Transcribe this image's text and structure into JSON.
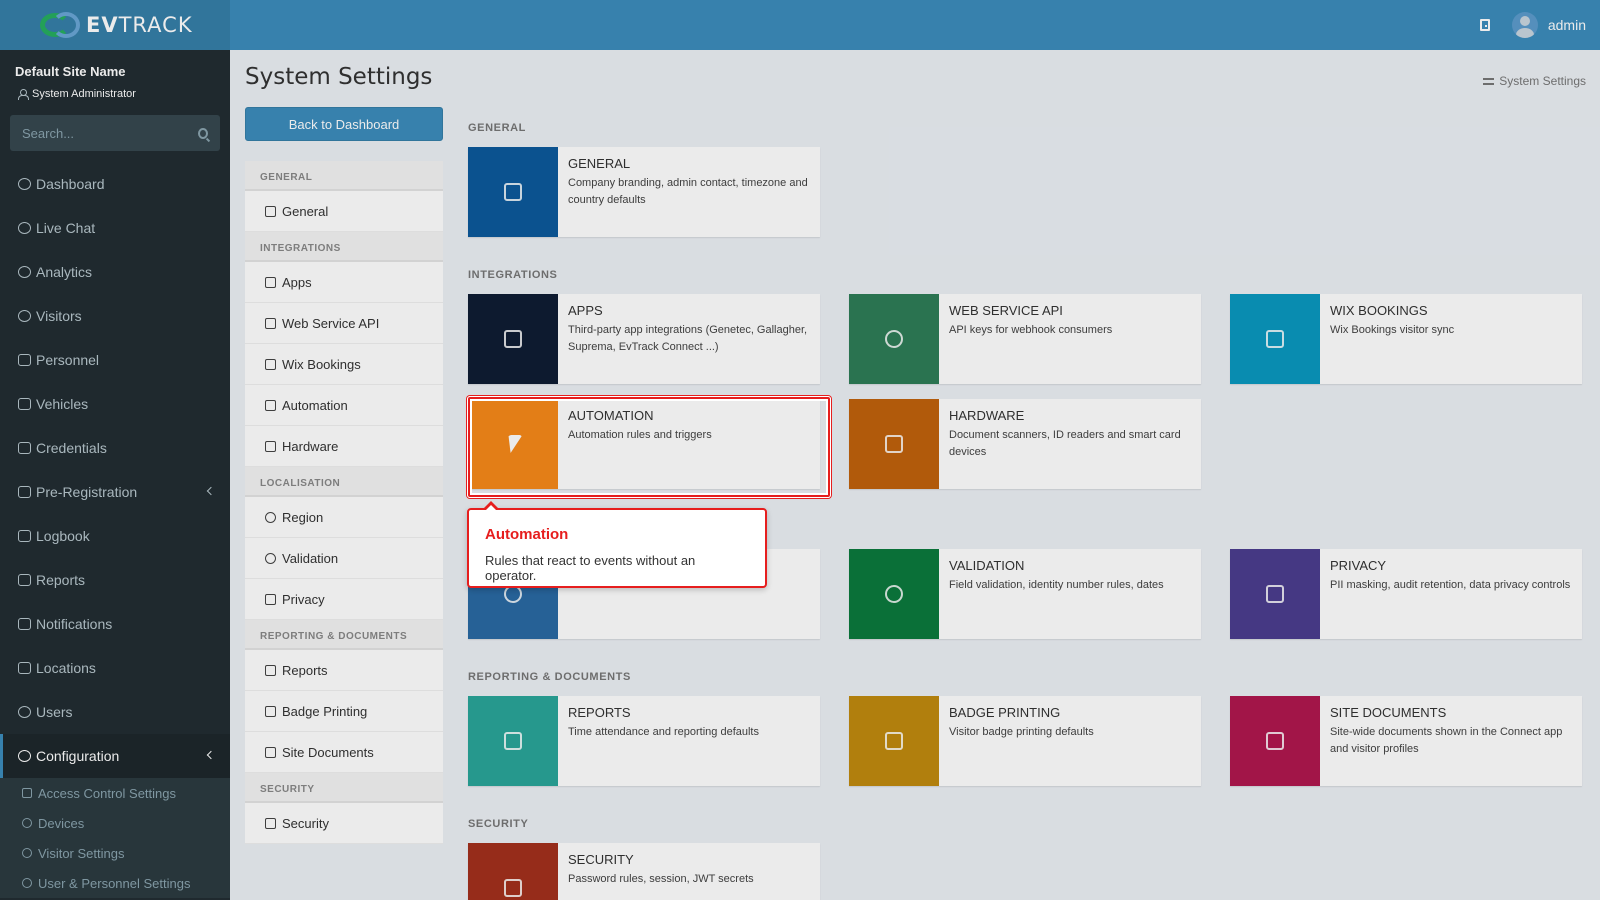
{
  "brand": {
    "logo_bold": "EV",
    "logo_rest": "TRACK"
  },
  "header": {
    "username": "admin"
  },
  "sidebar": {
    "site_name": "Default Site Name",
    "role": "System Administrator",
    "search_placeholder": "Search...",
    "items": [
      {
        "label": "Dashboard",
        "icon": "gauge-icon"
      },
      {
        "label": "Live Chat",
        "icon": "headset-icon"
      },
      {
        "label": "Analytics",
        "icon": "target-icon"
      },
      {
        "label": "Visitors",
        "icon": "eye-icon"
      },
      {
        "label": "Personnel",
        "icon": "user-tie-icon"
      },
      {
        "label": "Vehicles",
        "icon": "car-icon"
      },
      {
        "label": "Credentials",
        "icon": "id-card-icon"
      },
      {
        "label": "Pre-Registration",
        "icon": "exchange-icon"
      },
      {
        "label": "Logbook",
        "icon": "book-icon"
      },
      {
        "label": "Reports",
        "icon": "chart-area-icon"
      },
      {
        "label": "Notifications",
        "icon": "comment-icon"
      },
      {
        "label": "Locations",
        "icon": "map-icon"
      },
      {
        "label": "Users",
        "icon": "users-icon"
      },
      {
        "label": "Configuration",
        "icon": "cog-icon"
      }
    ],
    "sub_items": [
      {
        "label": "Access Control Settings",
        "icon": "lock-icon"
      },
      {
        "label": "Devices",
        "icon": "gear-icon"
      },
      {
        "label": "Visitor Settings",
        "icon": "eye-icon"
      },
      {
        "label": "User & Personnel Settings",
        "icon": "users-icon"
      }
    ]
  },
  "page": {
    "title": "System Settings",
    "breadcrumb": "System Settings",
    "back_button": "Back to Dashboard"
  },
  "settings_nav": {
    "general_head": "GENERAL",
    "general": [
      "General"
    ],
    "integrations_head": "INTEGRATIONS",
    "integrations": [
      "Apps",
      "Web Service API",
      "Wix Bookings",
      "Automation",
      "Hardware"
    ],
    "localisation_head": "LOCALISATION",
    "localisation": [
      "Region",
      "Validation",
      "Privacy"
    ],
    "reporting_head": "REPORTING & DOCUMENTS",
    "reporting": [
      "Reports",
      "Badge Printing",
      "Site Documents"
    ],
    "security_head": "SECURITY",
    "security": [
      "Security"
    ]
  },
  "sections": {
    "general": "GENERAL",
    "integrations": "INTEGRATIONS",
    "reporting": "REPORTING & DOCUMENTS",
    "security": "SECURITY"
  },
  "cards": {
    "general": {
      "title": "GENERAL",
      "desc": "Company branding, admin contact, timezone and country defaults",
      "color": "#0d5a9c",
      "icon": "server-icon"
    },
    "apps": {
      "title": "APPS",
      "desc": "Third-party app integrations (Genetec, Gallagher, Suprema, EvTrack Connect ...)",
      "color": "#0f1d33",
      "icon": "grid-dots-icon"
    },
    "webapi": {
      "title": "WEB SERVICE API",
      "desc": "API keys for webhook consumers",
      "color": "#2e7d57",
      "icon": "arrows-cross-icon"
    },
    "wix": {
      "title": "WIX BOOKINGS",
      "desc": "Wix Bookings visitor sync",
      "color": "#0a98bf",
      "icon": "calendar-icon"
    },
    "automation": {
      "title": "AUTOMATION",
      "desc": "Automation rules and triggers",
      "color": "#f7891a",
      "icon": "bolt-icon"
    },
    "hardware": {
      "title": "HARDWARE",
      "desc": "Document scanners, ID readers and smart card devices",
      "color": "#c0620d",
      "icon": "scanner-icon"
    },
    "region": {
      "title": "",
      "desc": "",
      "color": "#2a6aa3",
      "icon": "globe-icon"
    },
    "validation": {
      "title": "VALIDATION",
      "desc": "Field validation, identity number rules, dates",
      "color": "#0b7a3d",
      "icon": "check-circle-icon"
    },
    "privacy": {
      "title": "PRIVACY",
      "desc": "PII masking, audit retention, data privacy controls",
      "color": "#4b3d8f",
      "icon": "shield-icon"
    },
    "reports": {
      "title": "REPORTS",
      "desc": "Time attendance and reporting defaults",
      "color": "#2aa59a",
      "icon": "bar-chart-icon"
    },
    "badge": {
      "title": "BADGE PRINTING",
      "desc": "Visitor badge printing defaults",
      "color": "#c08a0f",
      "icon": "printer-icon"
    },
    "sitedocs": {
      "title": "SITE DOCUMENTS",
      "desc": "Site-wide documents shown in the Connect app and visitor profiles",
      "color": "#b0174f",
      "icon": "file-icon"
    },
    "security": {
      "title": "SECURITY",
      "desc": "Password rules, session, JWT secrets",
      "color": "#a3301d",
      "icon": "lock-icon"
    }
  },
  "tooltip": {
    "title": "Automation",
    "text": "Rules that react to events without an operator."
  }
}
